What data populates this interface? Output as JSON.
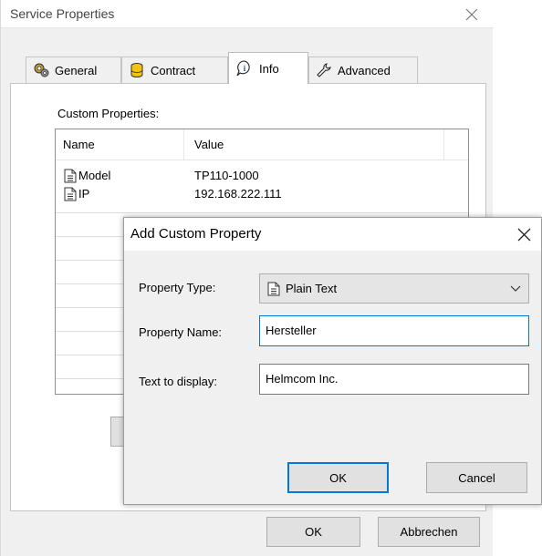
{
  "window": {
    "title": "Service Properties",
    "close_glyph": "✕"
  },
  "tabs": [
    {
      "label": "General",
      "icon": "gears-icon"
    },
    {
      "label": "Contract",
      "icon": "database-icon"
    },
    {
      "label": "Info",
      "icon": "info-icon"
    },
    {
      "label": "Advanced",
      "icon": "wrench-icon"
    }
  ],
  "active_tab": "Info",
  "custom_properties": {
    "label": "Custom Properties:",
    "columns": [
      "Name",
      "Value"
    ],
    "rows": [
      {
        "name": "Model",
        "value": "TP110-1000"
      },
      {
        "name": "IP",
        "value": "192.168.222.111"
      }
    ]
  },
  "footer": {
    "ok_label": "OK",
    "cancel_label": "Abbrechen"
  },
  "dialog": {
    "title": "Add Custom Property",
    "close_glyph": "✕",
    "property_type": {
      "label": "Property Type:",
      "value": "Plain Text"
    },
    "property_name": {
      "label": "Property Name:",
      "value": "Hersteller"
    },
    "text_to_display": {
      "label": "Text to display:",
      "value": "Helmcom Inc."
    },
    "ok_label": "OK",
    "cancel_label": "Cancel"
  },
  "colors": {
    "accent": "#0078d7",
    "window_bg": "#f0f0f0",
    "button_bg": "#e1e1e1"
  }
}
